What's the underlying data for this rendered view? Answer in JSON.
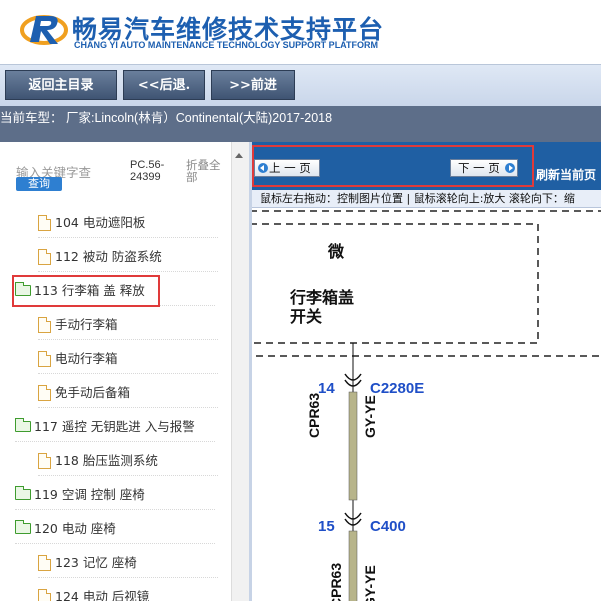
{
  "header": {
    "title": "畅易汽车维修技术支持平台",
    "subtitle": "CHANG YI AUTO MAINTENANCE TECHNOLOGY SUPPORT PLATFORM"
  },
  "toolbar": {
    "back_main": "返回主目录",
    "back": "<<后退.",
    "forward": ">>前进"
  },
  "model_bar": {
    "text": "当前车型： 厂家:Lincoln(林肯）Continental(大陆)2017-2018"
  },
  "sidebar": {
    "search_placeholder": "输入关键字查",
    "search_button": "查询",
    "pc_code": "PC.56-24399",
    "collapse_all": "折叠全部",
    "items": [
      {
        "label": "104 电动遮阳板",
        "type": "file"
      },
      {
        "label": "112 被动 防盗系统",
        "type": "file"
      },
      {
        "label": "113 行李箱 盖 释放",
        "type": "folder"
      },
      {
        "label": "手动行李箱",
        "type": "file"
      },
      {
        "label": "电动行李箱",
        "type": "file"
      },
      {
        "label": "免手动后备箱",
        "type": "file"
      },
      {
        "label": "117 遥控 无钥匙进 入与报警",
        "type": "folder"
      },
      {
        "label": "118 胎压监测系统",
        "type": "file"
      },
      {
        "label": "119 空调 控制 座椅",
        "type": "folder"
      },
      {
        "label": "120 电动 座椅",
        "type": "folder"
      },
      {
        "label": "123 记忆 座椅",
        "type": "file"
      },
      {
        "label": "124 电动 后视镜",
        "type": "file"
      }
    ]
  },
  "content": {
    "prev_page": "上 一 页",
    "next_page": "下 一 页",
    "refresh": "刷新当前页",
    "hint": "鼠标左右拖动：控制图片位置 | 鼠标滚轮向上:放大  滚轮向下：缩",
    "diagram": {
      "label_wei": "微",
      "label_switch_1": "行李箱盖",
      "label_switch_2": "开关",
      "pin_1": "14",
      "connector_1": "C2280E",
      "wire_1": "CPR63",
      "color_1": "GY-YE",
      "pin_2": "15",
      "connector_2": "C400",
      "wire_2": "CPR63",
      "color_2": "GY-YE"
    }
  },
  "colors": {
    "brand_blue": "#1d5fb0",
    "nav_blue": "#1f5fa3",
    "highlight_red": "#e03a3a",
    "wire_color": "#b7b48a"
  }
}
